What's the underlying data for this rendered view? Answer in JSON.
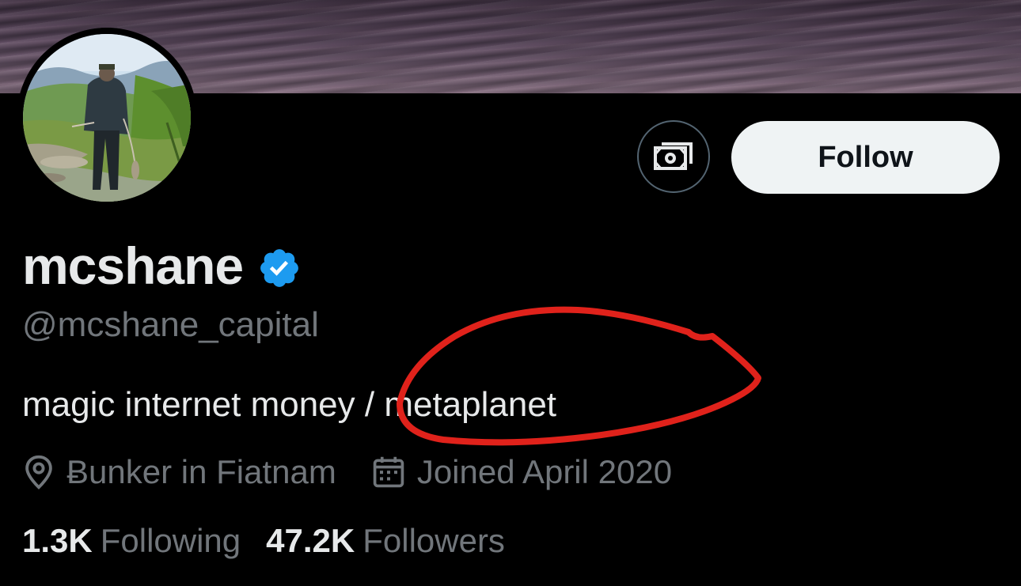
{
  "profile": {
    "display_name": "mcshane",
    "handle": "@mcshane_capital",
    "bio": "magic internet money / metaplanet",
    "location": "Ƀunker in Fiatnam",
    "joined": "Joined April 2020",
    "verified_icon": "verified-badge-icon"
  },
  "actions": {
    "tip_icon": "money-icon",
    "follow_label": "Follow"
  },
  "stats": {
    "following_count": "1.3K",
    "following_label": "Following",
    "followers_count": "47.2K",
    "followers_label": "Followers"
  },
  "colors": {
    "background": "#000000",
    "primary_text": "#e7e9ea",
    "secondary_text": "#71767b",
    "verified_blue": "#1d9bf0",
    "follow_button_bg": "#eff3f4",
    "annotation_red": "#e0221b"
  }
}
